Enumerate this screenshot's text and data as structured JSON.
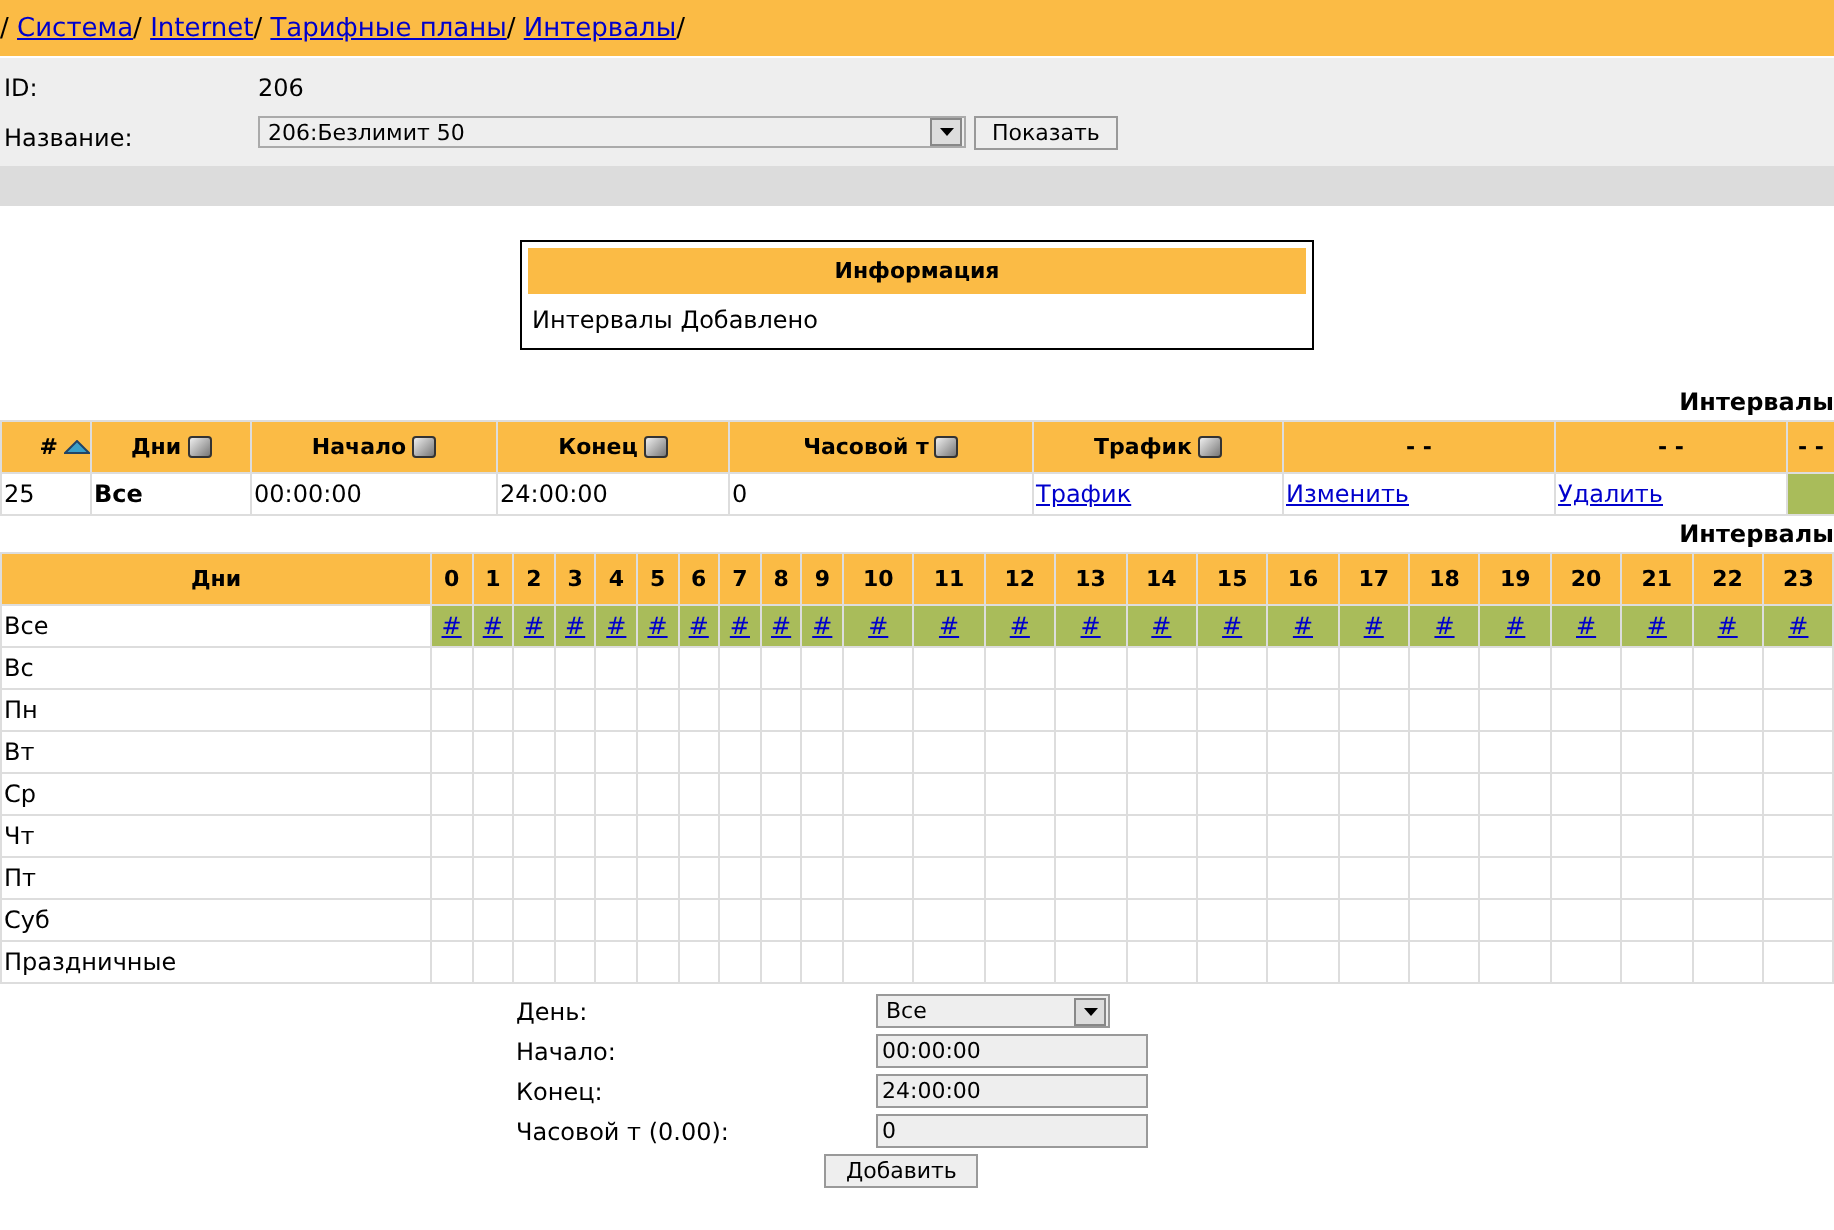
{
  "breadcrumb": {
    "lead": "/",
    "items": [
      {
        "label": "Система"
      },
      {
        "label": "Internet"
      },
      {
        "label": "Тарифные планы"
      },
      {
        "label": "Интервалы"
      }
    ]
  },
  "header_form": {
    "id_label": "ID:",
    "id_value": "206",
    "name_label": "Название:",
    "name_value": "206:Безлимит 50",
    "show_button": "Показать"
  },
  "info": {
    "title": "Информация",
    "message": "Интервалы Добавлено"
  },
  "intervals": {
    "caption": "Интервалы",
    "columns": [
      {
        "label": "#",
        "sorted": true
      },
      {
        "label": "Дни",
        "sorted": false
      },
      {
        "label": "Начало",
        "sorted": false
      },
      {
        "label": "Конец",
        "sorted": false
      },
      {
        "label": "Часовой т",
        "sorted": false
      },
      {
        "label": "Трафик",
        "sorted": false
      },
      {
        "label": "- -"
      },
      {
        "label": "- -"
      },
      {
        "label": "- -"
      }
    ],
    "rows": [
      {
        "id": "25",
        "days": "Все",
        "start": "00:00:00",
        "end": "24:00:00",
        "hourly": "0",
        "traffic_link": "Трафик",
        "edit_link": "Изменить",
        "delete_link": "Удалить",
        "color": "#a9bc5a"
      }
    ]
  },
  "schedule": {
    "caption": "Интервалы",
    "day_header": "Дни",
    "hours": [
      "0",
      "1",
      "2",
      "3",
      "4",
      "5",
      "6",
      "7",
      "8",
      "9",
      "10",
      "11",
      "12",
      "13",
      "14",
      "15",
      "16",
      "17",
      "18",
      "19",
      "20",
      "21",
      "22",
      "23"
    ],
    "rows": [
      {
        "day": "Все",
        "cells": [
          "#",
          "#",
          "#",
          "#",
          "#",
          "#",
          "#",
          "#",
          "#",
          "#",
          "#",
          "#",
          "#",
          "#",
          "#",
          "#",
          "#",
          "#",
          "#",
          "#",
          "#",
          "#",
          "#",
          "#"
        ]
      },
      {
        "day": "Вс"
      },
      {
        "day": "Пн"
      },
      {
        "day": "Вт"
      },
      {
        "day": "Ср"
      },
      {
        "day": "Чт"
      },
      {
        "day": "Пт"
      },
      {
        "day": "Суб"
      },
      {
        "day": "Праздничные"
      }
    ]
  },
  "add_form": {
    "day_label": "День:",
    "day_value": "Все",
    "start_label": "Начало:",
    "start_value": "00:00:00",
    "end_label": "Конец:",
    "end_value": "24:00:00",
    "hourly_label": "Часовой т (0.00):",
    "hourly_value": "0",
    "add_button": "Добавить"
  }
}
